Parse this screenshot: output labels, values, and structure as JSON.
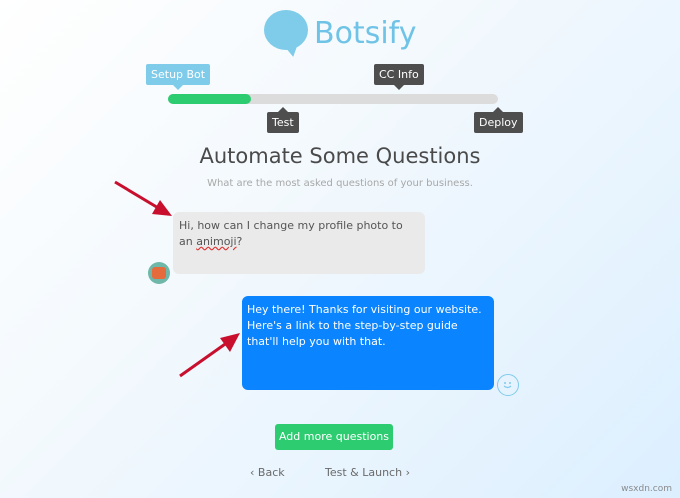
{
  "brand": {
    "name": "Botsify"
  },
  "wizard": {
    "steps": [
      {
        "label": "Setup Bot"
      },
      {
        "label": "CC Info"
      },
      {
        "label": "Test"
      },
      {
        "label": "Deploy"
      }
    ],
    "progress_fraction": 0.25
  },
  "page": {
    "title": "Automate Some Questions",
    "subtitle": "What are the most asked questions of your business."
  },
  "chat": {
    "user_message_part1": "Hi, how can I change my profile photo to an",
    "user_message_part2": "animoji",
    "user_message_part3": "?",
    "bot_message": "Hey there! Thanks for visiting our website. Here's a link to the step-by-step guide that'll help you with that."
  },
  "actions": {
    "add_more": "Add more questions",
    "back": "Back",
    "next": "Test & Launch"
  },
  "icons": {
    "back": "chevron-left-icon",
    "next": "chevron-right-icon"
  },
  "colors": {
    "accent_green": "#2ecc71",
    "bot_blue": "#0a84ff",
    "brand_light_blue": "#7fcbea"
  },
  "watermark": "wsxdn.com"
}
